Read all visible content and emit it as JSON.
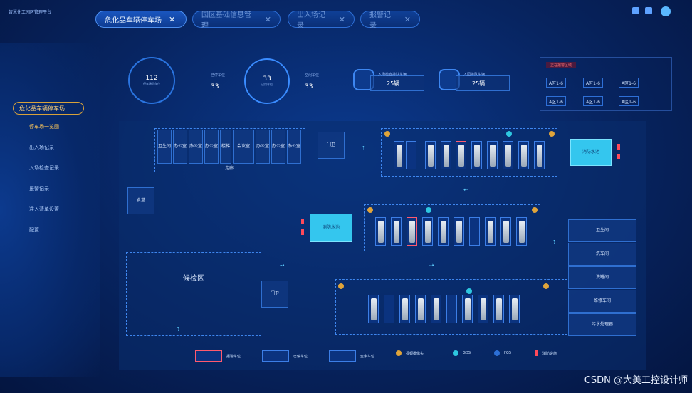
{
  "brand": "智慧化工园区管理平台",
  "tabs": [
    {
      "label": "危化品车辆停车场",
      "active": true
    },
    {
      "label": "园区基础信息管理",
      "active": false
    },
    {
      "label": "出入场记录",
      "active": false
    },
    {
      "label": "报警记录",
      "active": false
    }
  ],
  "tab_close": "✕",
  "sidebar": {
    "active_item": "危化品车辆停车场",
    "items": [
      "停车场一览图",
      "出入场记录",
      "入场检查记录",
      "报警记录",
      "准入清单设置",
      "配置"
    ]
  },
  "stats": {
    "total": {
      "value": "112",
      "label": "停车场总车位"
    },
    "used_label": "已停车位",
    "used_value": "33",
    "used_dial": {
      "value": "33",
      "label": "已用车位"
    },
    "free_label": "空闲车位",
    "free_value": "33",
    "card1": {
      "caption": "入场检查排队车辆",
      "value": "25辆"
    },
    "card2": {
      "caption": "入园排队车辆",
      "value": "25辆"
    },
    "alarm_title": "正在报警区域",
    "alarm_cells": [
      "A区1-6",
      "A区1-6",
      "A区1-6",
      "A区1-6",
      "A区1-6",
      "A区1-6"
    ]
  },
  "map": {
    "rooms_top": [
      "卫生间",
      "办公室",
      "办公室",
      "办公室",
      "楼梯",
      "会议室",
      "办公室",
      "办公室",
      "办公室"
    ],
    "corridor": "走廊",
    "gate": "门卫",
    "canteen": "食堂",
    "fire_pool": "消防水池",
    "waiting_area": "候检区",
    "right_rooms": [
      "卫生间",
      "洗车间",
      "洗罐间",
      "维修车间",
      "污水处理器"
    ]
  },
  "legend": [
    "报警车位",
    "已停车位",
    "空余车位",
    "视频摄像头",
    "GDS",
    "FGS",
    "消防设施"
  ],
  "watermark": "CSDN @大美工控设计师",
  "colors": {
    "alarm": "#ff5a6e",
    "accent": "#34c6ee",
    "gold": "#ffc85a"
  }
}
